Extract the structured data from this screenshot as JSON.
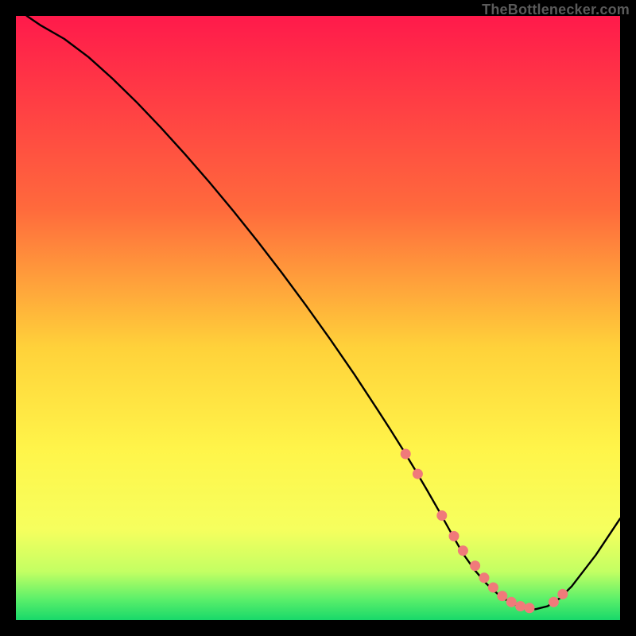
{
  "attribution": "TheBottlenecker.com",
  "chart_data": {
    "type": "line",
    "title": "",
    "xlabel": "",
    "ylabel": "",
    "xlim": [
      0,
      100
    ],
    "ylim": [
      0,
      100
    ],
    "background_gradient": {
      "stops": [
        {
          "offset": 0.0,
          "color": "#ff1a4b"
        },
        {
          "offset": 0.32,
          "color": "#ff6a3c"
        },
        {
          "offset": 0.55,
          "color": "#ffd23a"
        },
        {
          "offset": 0.72,
          "color": "#fff54a"
        },
        {
          "offset": 0.85,
          "color": "#f6ff5e"
        },
        {
          "offset": 0.92,
          "color": "#c3ff63"
        },
        {
          "offset": 0.965,
          "color": "#5cf06a"
        },
        {
          "offset": 1.0,
          "color": "#18d86a"
        }
      ]
    },
    "series": [
      {
        "name": "bottleneck-curve",
        "x": [
          1.8,
          4,
          8,
          12,
          16,
          20,
          24,
          28,
          32,
          36,
          40,
          44,
          48,
          52,
          56,
          60,
          62,
          64,
          66,
          68,
          70,
          72,
          74,
          76,
          78,
          80,
          82,
          84,
          86,
          88,
          90,
          92,
          96,
          100
        ],
        "y": [
          100,
          98.5,
          96.2,
          93.2,
          89.6,
          85.7,
          81.5,
          77.1,
          72.5,
          67.7,
          62.7,
          57.5,
          52.1,
          46.5,
          40.7,
          34.6,
          31.5,
          28.3,
          25.0,
          21.6,
          18.1,
          14.5,
          11.0,
          8.2,
          5.9,
          4.1,
          2.8,
          2.0,
          1.8,
          2.3,
          3.6,
          5.6,
          10.8,
          16.8
        ]
      }
    ],
    "markers": {
      "name": "sweet-spot-points",
      "color": "#f07a7a",
      "x": [
        64.5,
        66.5,
        70.5,
        72.5,
        74.0,
        76.0,
        77.5,
        79.0,
        80.5,
        82.0,
        83.5,
        85.0,
        89.0,
        90.5
      ],
      "y": [
        27.5,
        24.2,
        17.3,
        13.9,
        11.5,
        9.0,
        7.0,
        5.4,
        4.0,
        3.0,
        2.3,
        2.0,
        3.0,
        4.3
      ]
    }
  }
}
